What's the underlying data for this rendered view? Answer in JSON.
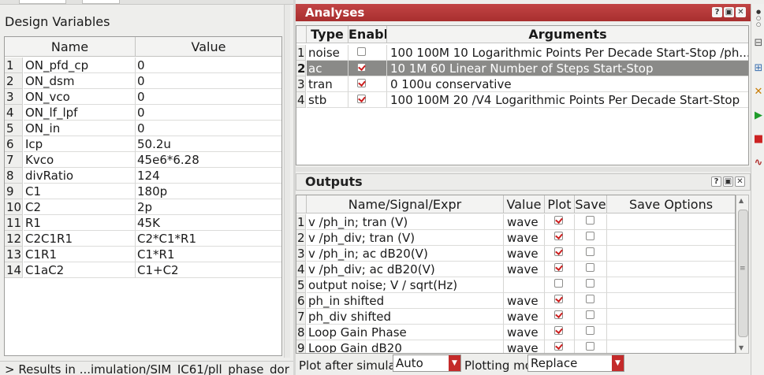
{
  "design_variables": {
    "title": "Design Variables",
    "columns": [
      "Name",
      "Value"
    ],
    "rows": [
      {
        "num": "1",
        "name": "ON_pfd_cp",
        "value": "0"
      },
      {
        "num": "2",
        "name": "ON_dsm",
        "value": "0"
      },
      {
        "num": "3",
        "name": "ON_vco",
        "value": "0"
      },
      {
        "num": "4",
        "name": "ON_lf_lpf",
        "value": "0"
      },
      {
        "num": "5",
        "name": "ON_in",
        "value": "0"
      },
      {
        "num": "6",
        "name": "Icp",
        "value": "50.2u"
      },
      {
        "num": "7",
        "name": "Kvco",
        "value": "45e6*6.28"
      },
      {
        "num": "8",
        "name": "divRatio",
        "value": "124"
      },
      {
        "num": "9",
        "name": "C1",
        "value": "180p"
      },
      {
        "num": "10",
        "name": "C2",
        "value": "2p"
      },
      {
        "num": "11",
        "name": "R1",
        "value": "45K"
      },
      {
        "num": "12",
        "name": "C2C1R1",
        "value": "C2*C1*R1"
      },
      {
        "num": "13",
        "name": "C1R1",
        "value": "C1*R1"
      },
      {
        "num": "14",
        "name": "C1aC2",
        "value": "C1+C2"
      }
    ],
    "status_text": "> Results in ...imulation/SIM_IC61/pll_phase_dor"
  },
  "analyses": {
    "title": "Analyses",
    "columns": [
      "Type",
      "Enable",
      "Arguments"
    ],
    "rows": [
      {
        "num": "1",
        "type": "noise",
        "enabled": false,
        "args": "100 100M 10 Logarithmic Points Per Decade Start-Stop /ph..."
      },
      {
        "num": "2",
        "type": "ac",
        "enabled": true,
        "args": "10 1M 60 Linear Number of Steps Start-Stop",
        "selected": true
      },
      {
        "num": "3",
        "type": "tran",
        "enabled": true,
        "args": "0 100u conservative"
      },
      {
        "num": "4",
        "type": "stb",
        "enabled": true,
        "args": "100 100M 20 /V4 Logarithmic Points Per Decade Start-Stop"
      }
    ]
  },
  "outputs": {
    "title": "Outputs",
    "columns": [
      "Name/Signal/Expr",
      "Value",
      "Plot",
      "Save",
      "Save Options"
    ],
    "rows": [
      {
        "num": "1",
        "name": "v /ph_in; tran (V)",
        "value": "wave",
        "plot": true,
        "save": false
      },
      {
        "num": "2",
        "name": "v /ph_div; tran (V)",
        "value": "wave",
        "plot": true,
        "save": false
      },
      {
        "num": "3",
        "name": "v /ph_in; ac dB20(V)",
        "value": "wave",
        "plot": true,
        "save": false
      },
      {
        "num": "4",
        "name": "v /ph_div; ac dB20(V)",
        "value": "wave",
        "plot": true,
        "save": false
      },
      {
        "num": "5",
        "name": "output noise; V / sqrt(Hz)",
        "value": "",
        "plot": false,
        "save": false
      },
      {
        "num": "6",
        "name": "ph_in shifted",
        "value": "wave",
        "plot": true,
        "save": false
      },
      {
        "num": "7",
        "name": "ph_div shifted",
        "value": "wave",
        "plot": true,
        "save": false
      },
      {
        "num": "8",
        "name": "Loop Gain Phase",
        "value": "wave",
        "plot": true,
        "save": false
      },
      {
        "num": "9",
        "name": "Loop Gain dB20",
        "value": "wave",
        "plot": true,
        "save": false
      }
    ]
  },
  "options": {
    "plot_after_label": "Plot after simula",
    "plot_after_value": "Auto",
    "plotting_mode_label": "Plotting mo",
    "plotting_mode_value": "Replace"
  },
  "dock_buttons": [
    "?",
    "▣",
    "✕"
  ],
  "icons": {
    "help": "help-icon",
    "float": "float-window-icon",
    "close": "close-icon",
    "dropdown": "dropdown-arrow-icon"
  },
  "colors": {
    "dock_header": "#b33a3a",
    "selection": "#8a8a88",
    "check": "#cc1f1f"
  }
}
